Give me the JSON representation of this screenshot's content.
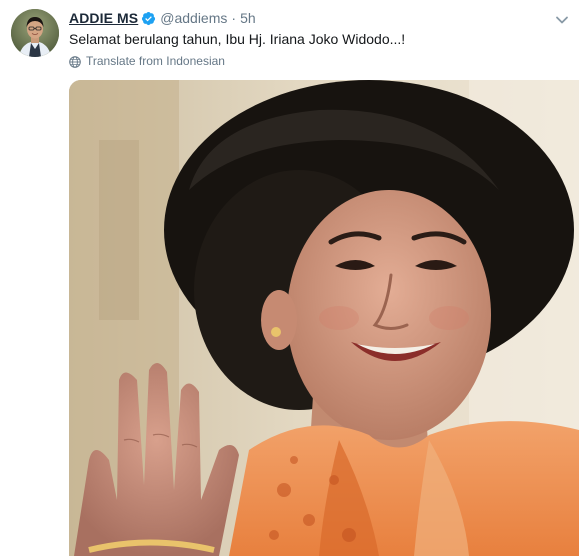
{
  "tweet": {
    "display_name": "ADDIE MS",
    "handle": "@addiems",
    "separator": "·",
    "time": "5h",
    "text": "Selamat berulang tahun, Ibu Hj. Iriana Joko Widodo...!",
    "translate_label": "Translate from Indonesian"
  },
  "icons": {
    "verified": "verified-badge-icon",
    "menu": "chevron-down-icon",
    "translate": "globe-icon"
  },
  "colors": {
    "name": "#1c2938",
    "secondary": "#657786",
    "text": "#14171a",
    "verified": "#1da1f2"
  }
}
